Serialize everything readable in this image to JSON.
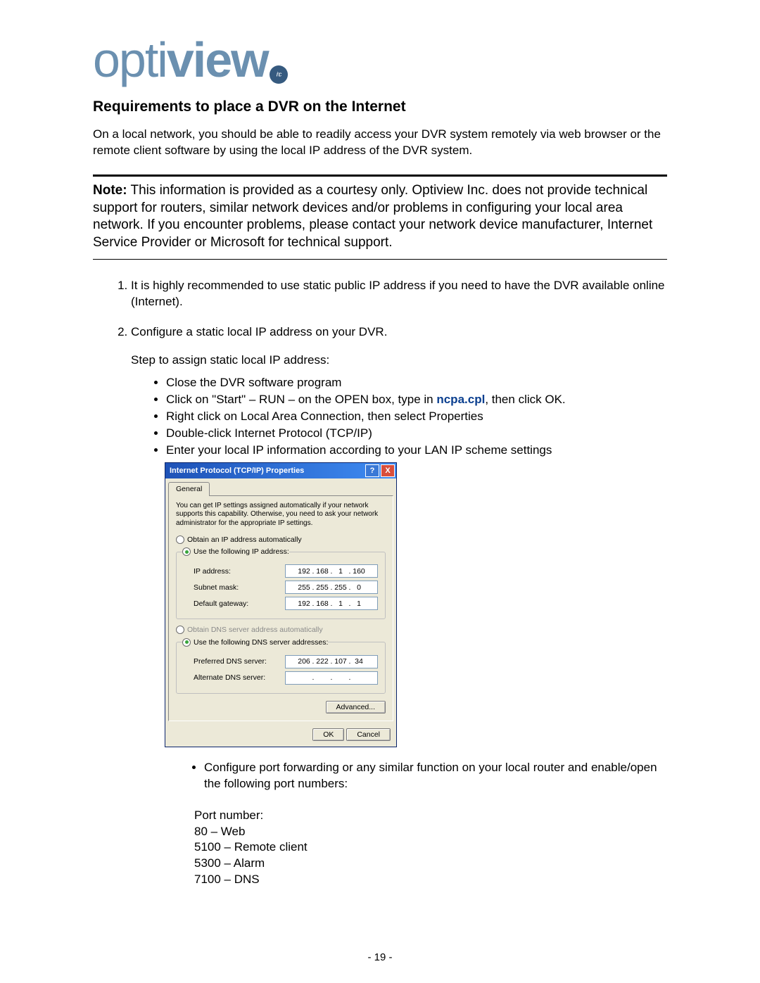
{
  "logo": {
    "pre": "opti",
    "bold": "view",
    "badge": "inc"
  },
  "title": "Requirements to place a DVR on the Internet",
  "intro": "On a local network, you should be able to readily access your DVR system remotely via web browser or the remote client software by using the local IP address of the DVR system.",
  "note_label": "Note:",
  "note_body": "This information is provided as a courtesy only. Optiview Inc. does not provide technical support for routers, similar network devices and/or problems in configuring your local area network. If you encounter problems, please contact your network device manufacturer, Internet Service Provider or Microsoft for technical support.",
  "step1": "It is highly recommended to use static public IP address if you need to have the DVR available online (Internet).",
  "step2": "Configure a static local IP address on your DVR.",
  "step2_sub": "Step to assign static local IP address:",
  "bullets": {
    "b1": "Close the DVR software program",
    "b2_pre": "Click on \"Start\" – RUN – on the OPEN box, type in ",
    "b2_cmd": "ncpa.cpl",
    "b2_post": ", then click OK.",
    "b3": "Right click on Local Area Connection, then select Properties",
    "b4": "Double-click Internet Protocol (TCP/IP)",
    "b5": "Enter your local IP information according to your LAN IP scheme settings"
  },
  "dialog": {
    "title": "Internet Protocol (TCP/IP) Properties",
    "help": "?",
    "close": "X",
    "tab": "General",
    "desc": "You can get IP settings assigned automatically if your network supports this capability. Otherwise, you need to ask your network administrator for the appropriate IP settings.",
    "r_auto_ip": "Obtain an IP address automatically",
    "r_use_ip": "Use the following IP address:",
    "ip_label": "IP address:",
    "ip_value": [
      "192",
      "168",
      "1",
      "160"
    ],
    "mask_label": "Subnet mask:",
    "mask_value": [
      "255",
      "255",
      "255",
      "0"
    ],
    "gw_label": "Default gateway:",
    "gw_value": [
      "192",
      "168",
      "1",
      "1"
    ],
    "r_auto_dns": "Obtain DNS server address automatically",
    "r_use_dns": "Use the following DNS server addresses:",
    "pdns_label": "Preferred DNS server:",
    "pdns_value": [
      "206",
      "222",
      "107",
      "34"
    ],
    "adns_label": "Alternate DNS server:",
    "adns_value": [
      "",
      "",
      "",
      ""
    ],
    "advanced": "Advanced...",
    "ok": "OK",
    "cancel": "Cancel"
  },
  "post_bullet": "Configure port forwarding or any similar function on your local router and enable/open the following port numbers:",
  "ports_header": "Port number:",
  "ports": {
    "p1": "80 – Web",
    "p2": "5100 – Remote client",
    "p3": "5300 – Alarm",
    "p4": "7100 – DNS"
  },
  "page_number": "- 19 -"
}
